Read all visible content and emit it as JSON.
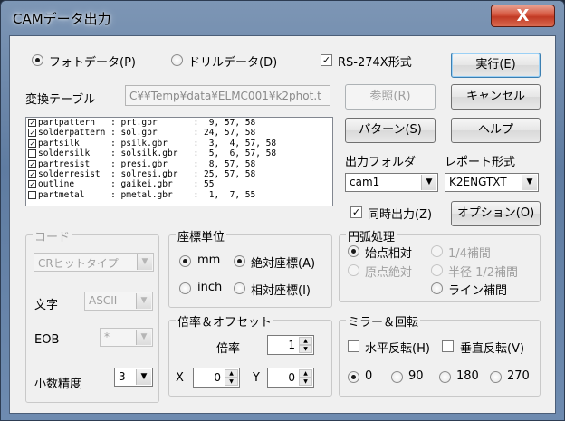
{
  "window": {
    "title": "CAMデータ出力",
    "close_glyph": "X"
  },
  "top": {
    "photo_radio": "フォトデータ(P)",
    "drill_radio": "ドリルデータ(D)",
    "rs274x_check": "RS-274X形式",
    "rs274x_checked": true,
    "check_mark": "✓",
    "conversion_table_label": "変換テーブル",
    "conversion_table_path": "C¥¥Temp¥data¥ELMC001¥k2phot.t"
  },
  "buttons": {
    "execute": "実行(E)",
    "cancel": "キャンセル",
    "browse": "参照(R)",
    "pattern": "パターン(S)",
    "help": "ヘルプ",
    "options": "オプション(O)"
  },
  "layers": [
    {
      "checked": true,
      "text": "partpattern   : prt.gbr       :  9, 57, 58"
    },
    {
      "checked": true,
      "text": "solderpattern : sol.gbr       : 24, 57, 58"
    },
    {
      "checked": true,
      "text": "partsilk      : psilk.gbr     :  3,  4, 57, 58"
    },
    {
      "checked": false,
      "text": "soldersilk    : solsilk.gbr   :  5,  6, 57, 58"
    },
    {
      "checked": true,
      "text": "partresist    : presi.gbr     :  8, 57, 58"
    },
    {
      "checked": true,
      "text": "solderresist  : solresi.gbr   : 25, 57, 58"
    },
    {
      "checked": true,
      "text": "outline       : gaikei.gbr    : 55"
    },
    {
      "checked": false,
      "text": "partmetal     : pmetal.gbr    :  1,  7, 55"
    }
  ],
  "output": {
    "folder_label": "出力フォルダ",
    "folder_value": "cam1",
    "report_label": "レポート形式",
    "report_value": "K2ENGTXT",
    "simultaneous_check": "同時出力(Z)",
    "simultaneous_checked": true
  },
  "code_group": {
    "title": "コード",
    "type_value": "CRヒットタイプ",
    "char_label": "文字",
    "char_value": "ASCII",
    "eob_label": "EOB",
    "eob_value": "*",
    "precision_label": "小数精度",
    "precision_value": "3"
  },
  "coord_group": {
    "title": "座標単位",
    "mm": "mm",
    "inch": "inch",
    "absolute": "絶対座標(A)",
    "relative": "相対座標(I)"
  },
  "arc_group": {
    "title": "円弧処理",
    "start_relative": "始点相対",
    "quarter": "1/4補間",
    "origin_absolute": "原点絶対",
    "half_radius": "半径 1/2補間",
    "line": "ライン補間"
  },
  "scale_group": {
    "title": "倍率＆オフセット",
    "scale_label": "倍率",
    "scale_value": "1",
    "x_label": "X",
    "x_value": "0",
    "y_label": "Y",
    "y_value": "0"
  },
  "mirror_group": {
    "title": "ミラー＆回転",
    "h_flip": "水平反転(H)",
    "v_flip": "垂直反転(V)",
    "rotations": [
      "0",
      "90",
      "180",
      "270"
    ],
    "selected_rotation": "0"
  },
  "icons": {
    "dropdown": "dropdown-arrow-icon",
    "spin": "spin-arrows-icon"
  }
}
